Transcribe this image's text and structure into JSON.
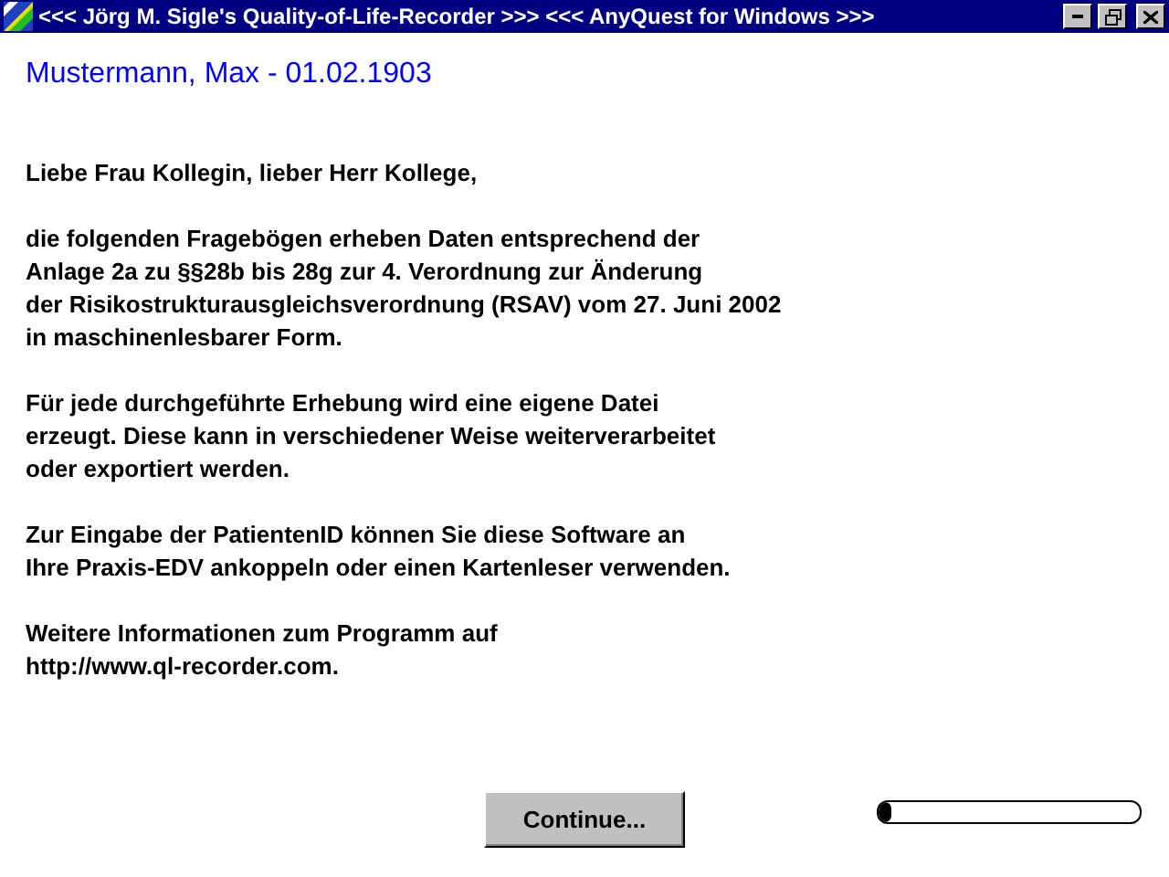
{
  "window": {
    "title": "<<< Jörg M. Sigle's Quality-of-Life-Recorder >>> <<< AnyQuest for Windows >>>"
  },
  "patient": "Mustermann, Max - 01.02.1903",
  "paragraphs": [
    "Liebe Frau Kollegin, lieber Herr Kollege,",
    "die folgenden Fragebögen erheben Daten entsprechend der\nAnlage 2a zu §§28b bis 28g zur 4. Verordnung zur Änderung\nder Risikostrukturausgleichsverordnung (RSAV) vom 27. Juni 2002\nin maschinenlesbarer Form.",
    "Für jede durchgeführte Erhebung wird eine eigene Datei\nerzeugt. Diese kann in verschiedener Weise weiterverarbeitet\noder exportiert werden.",
    "Zur Eingabe der PatientenID können Sie diese Software an\nIhre Praxis-EDV ankoppeln oder einen Kartenleser verwenden.",
    "Weitere Informationen zum Programm auf\nhttp://www.ql-recorder.com."
  ],
  "continue_button": "Continue...",
  "progress": {
    "level": 0.05
  }
}
